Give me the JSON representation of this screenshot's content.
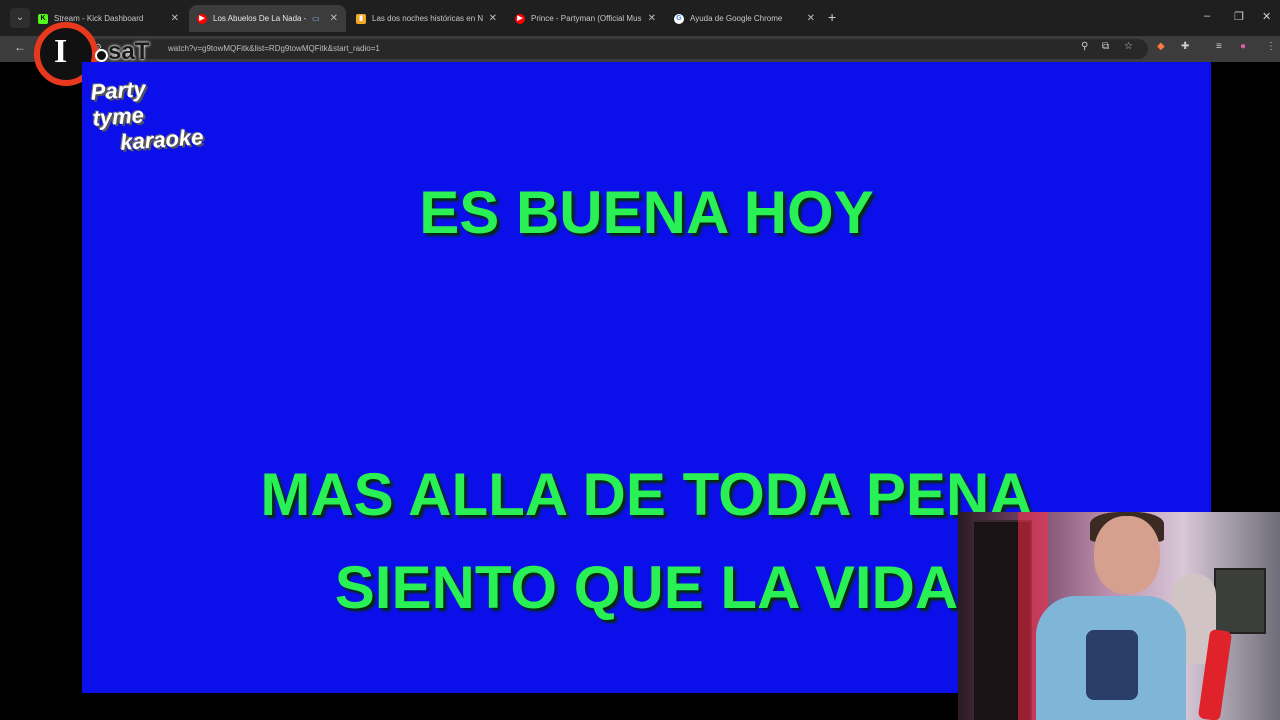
{
  "browser": {
    "tabs": [
      {
        "favicon": "kick-icon",
        "favicon_glyph": "K",
        "favicon_color": "#53fc18",
        "title": "Stream - Kick Dashboard",
        "active": false
      },
      {
        "favicon": "youtube-icon",
        "favicon_glyph": "▶",
        "favicon_color": "#ff0000",
        "title": "Los Abuelos De La Nada - L",
        "active": true
      },
      {
        "favicon": "page-icon",
        "favicon_glyph": "▮",
        "favicon_color": "#f5a623",
        "title": "Las dos noches históricas en N",
        "active": false
      },
      {
        "favicon": "youtube-icon",
        "favicon_glyph": "▶",
        "favicon_color": "#ff0000",
        "title": "Prince - Partyman (Official Mus",
        "active": false
      },
      {
        "favicon": "google-icon",
        "favicon_glyph": "G",
        "favicon_color": "#4285f4",
        "title": "Ayuda de Google Chrome",
        "active": false
      }
    ],
    "url": "watch?v=g9towMQFitk&list=RDg9towMQFitk&start_radio=1"
  },
  "overlay_logo": {
    "letter": "I",
    "word": "saT"
  },
  "video": {
    "background": "#0b10ea",
    "lyric_color": "#29f055",
    "brand": {
      "line1": "Party tyme",
      "line2": "karaoke"
    },
    "lyrics": [
      "ES BUENA HOY",
      "MAS ALLA DE TODA PENA",
      "SIENTO QUE LA VIDA"
    ]
  },
  "colors": {
    "accent_ring": "#e8381e",
    "tab_bar": "#1f1f1f",
    "toolbar": "#3c3c3c"
  }
}
